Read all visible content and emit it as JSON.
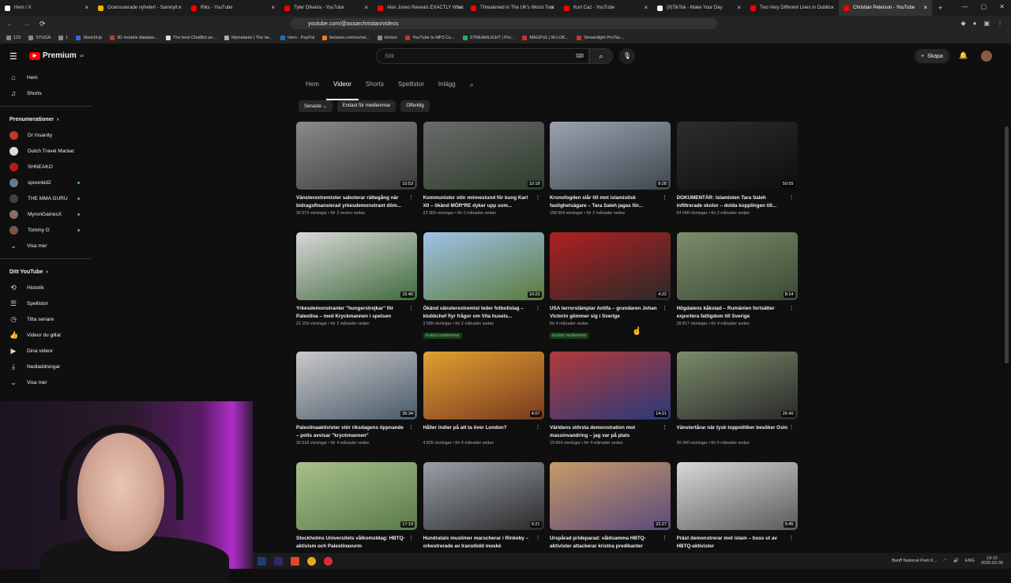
{
  "browser": {
    "tabs": [
      {
        "label": "Hem / X",
        "color": "#ffffff"
      },
      {
        "label": "Ocensurerade nyheter! - Samnytt",
        "color": "#f4b400"
      },
      {
        "label": "Riks - YouTube",
        "color": "#ff0000"
      },
      {
        "label": "Tyler Oliveira - YouTube",
        "color": "#ff0000"
      },
      {
        "label": "Alex Jones Reveals EXACTLY What",
        "color": "#ff0000"
      },
      {
        "label": "Threatened in The UK's Worst Tow",
        "color": "#ff0000"
      },
      {
        "label": "Kurt Caz - YouTube",
        "color": "#ff0000"
      },
      {
        "label": "(9)TikTok - Make Your Day",
        "color": "#ffffff"
      },
      {
        "label": "Two Very Different Lives in Dublin",
        "color": "#ff0000"
      },
      {
        "label": "Christian Peterson - YouTube",
        "color": "#ff0000",
        "active": true
      }
    ],
    "url": "youtube.com/@assarchristian/videos",
    "bookmarks": [
      "123",
      "STUGA",
      "1",
      "SketchUp",
      "3D models databas...",
      "The best ChatBot an...",
      "Myinstants | The lar...",
      "Hem - PayPal",
      "betsson.com/sv/od...",
      "böcker",
      "YouTube to MP3 Co...",
      "STREAMLIGHT | Pro...",
      "MAGPUL | M-LOK...",
      "Streamlight ProTac..."
    ]
  },
  "youtube": {
    "logo_text": "Premium",
    "logo_region": "SE",
    "search_placeholder": "Sök",
    "create_label": "Skapa"
  },
  "sidebar": {
    "main": [
      {
        "icon": "home-icon",
        "glyph": "⌂",
        "label": "Hem"
      },
      {
        "icon": "shorts-icon",
        "glyph": "♫",
        "label": "Shorts"
      }
    ],
    "subs_title": "Prenumerationer",
    "subs": [
      {
        "label": "Dr Insanity",
        "color": "#c0392b",
        "dot": false
      },
      {
        "label": "Dutch Travel Maniac",
        "color": "#dddddd",
        "dot": false
      },
      {
        "label": "SHNEAKO",
        "color": "#b71c1c",
        "dot": false
      },
      {
        "label": "spoonkid2",
        "color": "#607d8b",
        "dot": true
      },
      {
        "label": "THE MMA GURU",
        "color": "#424242",
        "dot": true
      },
      {
        "label": "MyronGainesX",
        "color": "#8d6e63",
        "dot": true
      },
      {
        "label": "Tommy G",
        "color": "#795548",
        "dot": true
      }
    ],
    "subs_more": "Visa mer",
    "you_title": "Ditt YouTube",
    "you": [
      {
        "icon": "history-icon",
        "glyph": "⟲",
        "label": "Historik"
      },
      {
        "icon": "playlists-icon",
        "glyph": "☰",
        "label": "Spellistor"
      },
      {
        "icon": "watch-later-icon",
        "glyph": "◷",
        "label": "Titta senare"
      },
      {
        "icon": "liked-icon",
        "glyph": "👍",
        "label": "Videor du gillat"
      },
      {
        "icon": "your-videos-icon",
        "glyph": "▶",
        "label": "Dina videor"
      },
      {
        "icon": "downloads-icon",
        "glyph": "⤓",
        "label": "Nedladdningar"
      }
    ],
    "you_more": "Visa mer"
  },
  "channel_tabs": [
    "Hem",
    "Videor",
    "Shorts",
    "Spellistor",
    "Inlägg"
  ],
  "chips": [
    "Senaste",
    "Endast för medlemmar",
    "Offentlig"
  ],
  "videos": [
    {
      "title": "Vänsterextremister saboterar rättegång när bidragsfinansierad yrkesdemonstrant döm...",
      "views": "30 573 visningar",
      "age": "för 3 veckor sedan",
      "duration": "10:53",
      "c1": "#8a8a8a",
      "c2": "#3a3a3a"
    },
    {
      "title": "Kommunister stör minnestund för kung Karl XII – ökänd MÖR*RE dyker upp som...",
      "views": "23 369 visningar",
      "age": "för 2 månader sedan",
      "duration": "10:18",
      "c1": "#6b6b6b",
      "c2": "#2c3d2a"
    },
    {
      "title": "Kronofogden slår till mot islamistisk fastighetsägare – Tara Saleh jagas för...",
      "views": "168 504 visningar",
      "age": "för 2 månader sedan",
      "duration": "8:28",
      "c1": "#9aa3ad",
      "c2": "#3e4750"
    },
    {
      "title": "DOKUMENTÄR: Islamisten Tara Saleh infiltrerade skolor – dolda kopplingen till...",
      "views": "64 048 visningar",
      "age": "för 2 månader sedan",
      "duration": "50:55",
      "c1": "#2d2d2d",
      "c2": "#0e0e0e"
    },
    {
      "title": "Yrkesdemonstranter \"hungerstrejkar\" för Palestina – med Kryckmannen i spetsen",
      "views": "21 159 visningar",
      "age": "för 2 månader sedan",
      "duration": "15:40",
      "c1": "#d8d8d8",
      "c2": "#3f6a3b"
    },
    {
      "title": "Ökänd vänsterextremist leder fotbollslag – klubbchef flyr frågor om Vita husets...",
      "views": "3 589 visningar",
      "age": "för 2 månader sedan",
      "duration": "10:23",
      "c1": "#9fc3e8",
      "c2": "#5b7a3c",
      "badge": "Endast medlemmar"
    },
    {
      "title": "USA terrorstämplar Antifa – grundaren Johan Victorin gömmer sig i Sverige",
      "views": "",
      "age": "för 4 månader sedan",
      "duration": "4:22",
      "c1": "#b02020",
      "c2": "#2a2a2a",
      "badge": "Endast medlemmar"
    },
    {
      "title": "Högdalens kåkstad – Rumänien fortsätter exportera fattigdom till Sverige",
      "views": "28 817 visningar",
      "age": "för 4 månader sedan",
      "duration": "8:14",
      "c1": "#7d8c6a",
      "c2": "#3b4a35"
    },
    {
      "title": "Palestinaaktivister stör riksdagens öppnande – polis avvisar \"kryckmannen\"",
      "views": "30 618 visningar",
      "age": "för 4 månader sedan",
      "duration": "35:34",
      "c1": "#c9c9c9",
      "c2": "#4a5a6a"
    },
    {
      "title": "Håller indier på att ta över London?",
      "views": "4 825 visningar",
      "age": "för 4 månader sedan",
      "duration": "4:07",
      "c1": "#e0a030",
      "c2": "#7a3a20"
    },
    {
      "title": "Världens största demonstration mot massinvandring – jag var på plats",
      "views": "19 664 visningar",
      "age": "för 4 månader sedan",
      "duration": "14:21",
      "c1": "#b03a3a",
      "c2": "#2a3a7a"
    },
    {
      "title": "Vänstertårar när tysk toppolitiker besöker Oslo",
      "views": "30 940 visningar",
      "age": "för 5 månader sedan",
      "duration": "26:40",
      "c1": "#7a8a6a",
      "c2": "#2a2a2a"
    },
    {
      "title": "Stockholms Universitets vålkomstdag: HBTQ-aktivism och Palestinavurm",
      "views": "",
      "age": "",
      "duration": "17:19",
      "c1": "#a8c08a",
      "c2": "#5a7a4a"
    },
    {
      "title": "Hundratals muslimer marscherar i Rinkeby – orkestrerade av Iranstödd moské",
      "views": "",
      "age": "",
      "duration": "9:21",
      "c1": "#9aa0a8",
      "c2": "#2a2a2a"
    },
    {
      "title": "Urspårad prideparad: våldsamma HBTQ-aktivister attackerar kristna predikanter",
      "views": "",
      "age": "",
      "duration": "22:27",
      "c1": "#c89a6a",
      "c2": "#5a4a7a"
    },
    {
      "title": "Präst demonstrerar mot islam – buss ut av HBTQ-aktivister",
      "views": "",
      "age": "",
      "duration": "5:45",
      "c1": "#d8d8d8",
      "c2": "#5a5a5a"
    }
  ],
  "taskbar": {
    "tray_label": "Banff National Park K...",
    "lang": "ENG",
    "time": "19:10",
    "date": "2026-02-09"
  }
}
